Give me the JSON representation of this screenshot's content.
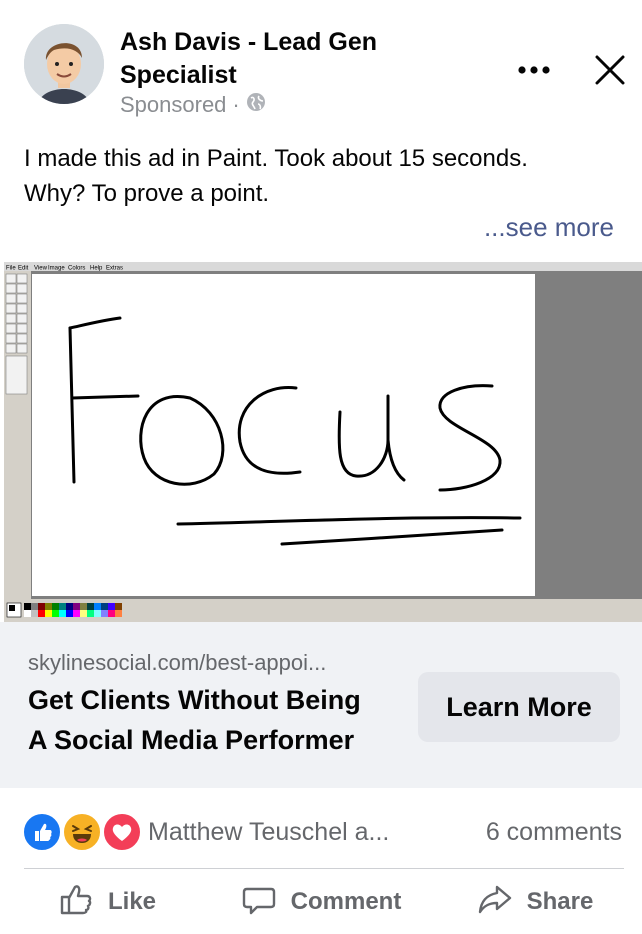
{
  "post": {
    "author": "Ash Davis - Lead Gen Specialist",
    "sponsored": "Sponsored",
    "separator": "·",
    "text_line1": "I made this ad in Paint. Took about 15 seconds.",
    "text_line2": "Why? To prove a point.",
    "see_more": "...see more"
  },
  "image": {
    "menu": [
      "File",
      "Edit",
      "View",
      "Image",
      "Colors",
      "Help",
      "Extras"
    ],
    "drawn_word": "Focus"
  },
  "link": {
    "domain": "skylinesocial.com/best-appoi...",
    "headline_line1": "Get Clients Without Being",
    "headline_line2": "A Social Media Performer",
    "cta": "Learn More"
  },
  "engagement": {
    "reactions": [
      "like",
      "haha",
      "love"
    ],
    "reactors": "Matthew Teuschel a...",
    "comments": "6 comments"
  },
  "actions": {
    "like": "Like",
    "comment": "Comment",
    "share": "Share"
  },
  "colors": {
    "like_blue": "#1877f2",
    "love_red": "#f33e58",
    "haha_yellow": "#f7b125",
    "see_more": "#4a5a8c"
  }
}
